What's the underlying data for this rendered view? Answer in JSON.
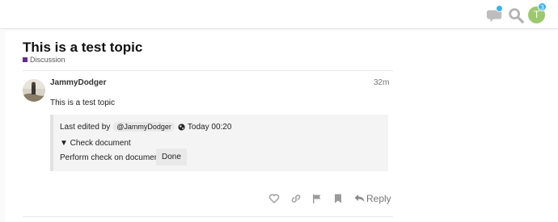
{
  "header": {
    "icons": [
      "chat-icon",
      "search-icon"
    ],
    "avatar_letter": "T",
    "notification_count": "3",
    "colors": {
      "accent": "#3ab3f0",
      "avatar_bg": "#9cc96f"
    }
  },
  "topic": {
    "title": "This is a test topic",
    "category": "Discussion",
    "category_color": "#652d90"
  },
  "post": {
    "username": "JammyDodger",
    "time": "32m",
    "body": "This is a test topic",
    "quote": {
      "edited_label": "Last edited by",
      "mention": "@JammyDodger",
      "edited_time": "Today 00:20",
      "details_summary": "▼ Check document",
      "check_label": "Perform check on document:",
      "done_label": "Done"
    },
    "actions": {
      "icons": [
        "heart-icon",
        "link-icon",
        "flag-icon",
        "bookmark-icon"
      ],
      "reply_label": "Reply"
    }
  }
}
